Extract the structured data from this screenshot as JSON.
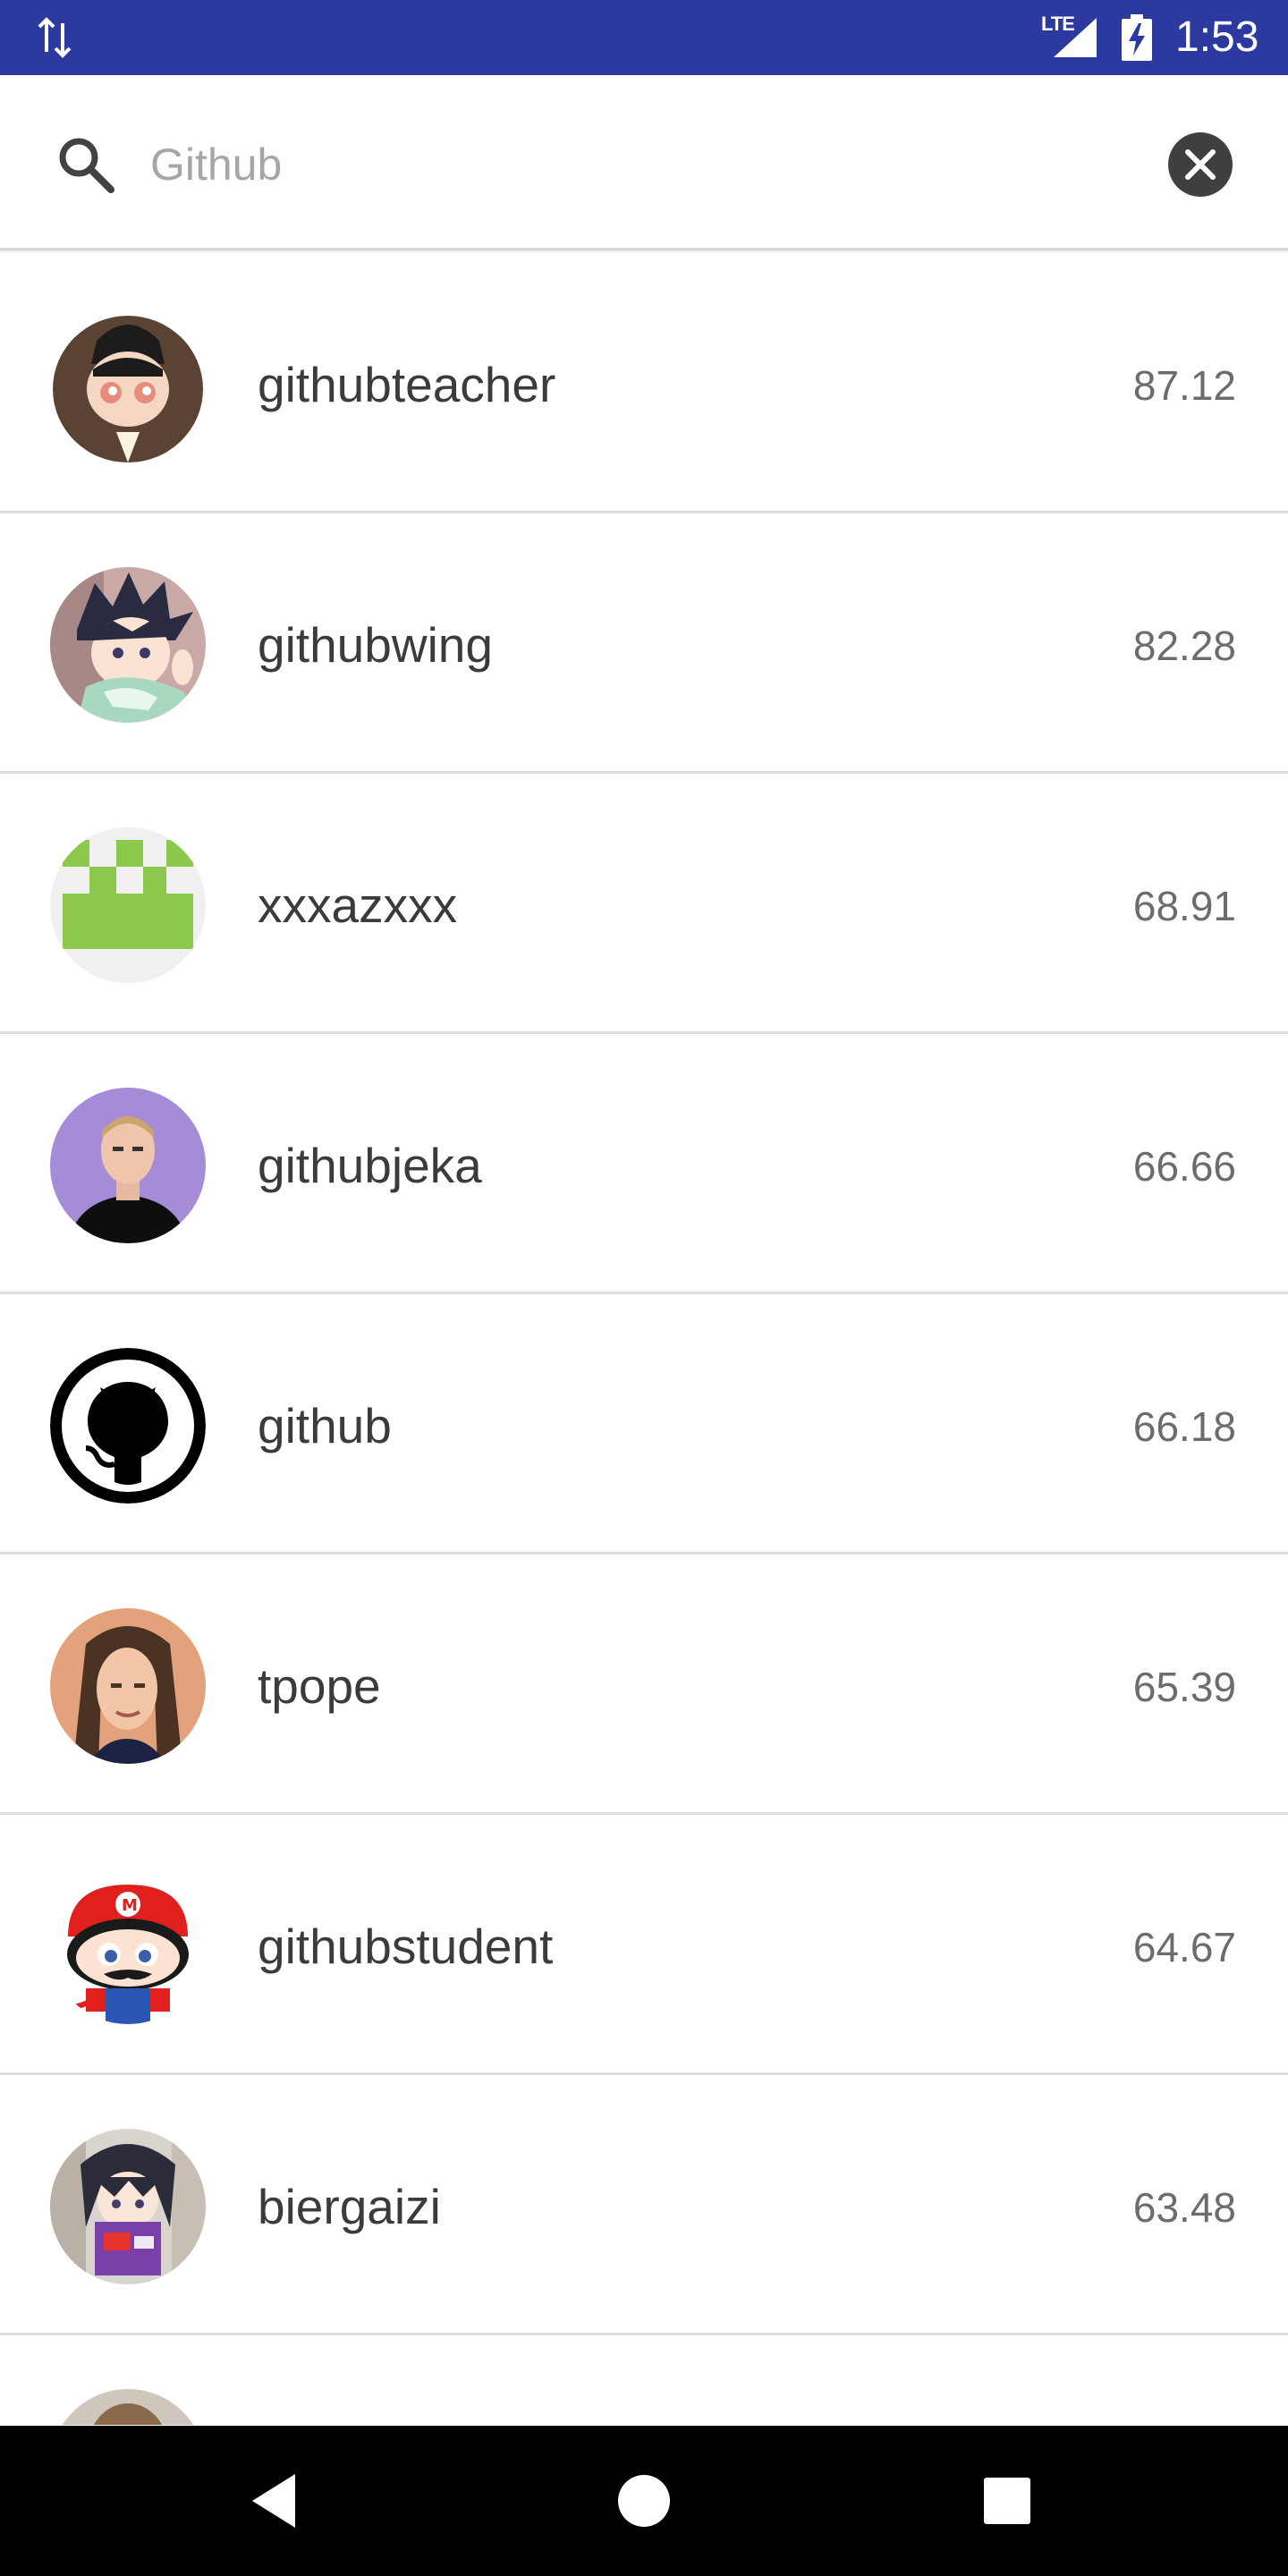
{
  "status_bar": {
    "time": "1:53",
    "network_label": "LTE",
    "icons": [
      "data-activity-icon",
      "signal-icon",
      "battery-charging-icon"
    ]
  },
  "search": {
    "placeholder": "Github",
    "value": "",
    "icon": "search-icon",
    "clear_icon": "clear-icon"
  },
  "results": [
    {
      "username": "githubteacher",
      "score": "87.12",
      "avatar": "octocat-teacher-avatar"
    },
    {
      "username": "githubwing",
      "score": "82.28",
      "avatar": "anime-character-avatar"
    },
    {
      "username": "xxxazxxx",
      "score": "68.91",
      "avatar": "identicon-avatar"
    },
    {
      "username": "githubjeka",
      "score": "66.66",
      "avatar": "person-photo-avatar"
    },
    {
      "username": "github",
      "score": "66.18",
      "avatar": "github-logo-avatar"
    },
    {
      "username": "tpope",
      "score": "65.39",
      "avatar": "person-photo-avatar"
    },
    {
      "username": "githubstudent",
      "score": "64.67",
      "avatar": "octocat-mario-avatar"
    },
    {
      "username": "biergaizi",
      "score": "63.48",
      "avatar": "anime-character-avatar"
    },
    {
      "username": "",
      "score": "",
      "avatar": "person-photo-avatar"
    }
  ],
  "nav_bar": {
    "icons": [
      "back-icon",
      "home-icon",
      "recents-icon"
    ]
  },
  "colors": {
    "status_bar": "#2c3a9f",
    "text_primary": "#3b3b3b",
    "text_secondary": "#6c6c6c",
    "divider": "#dddddd"
  }
}
